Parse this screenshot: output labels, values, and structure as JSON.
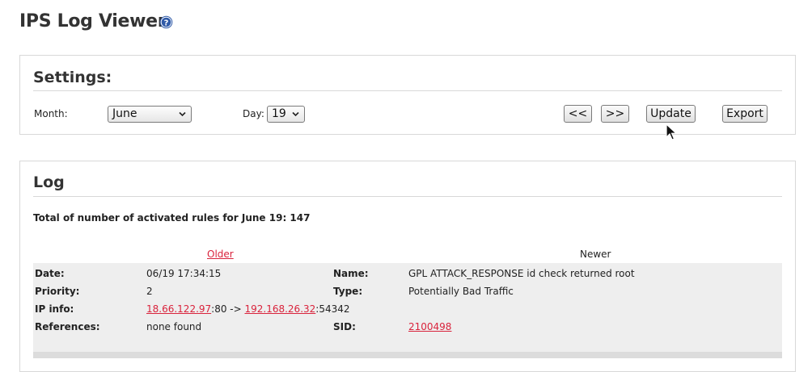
{
  "page": {
    "title": "IPS Log Viewer"
  },
  "settings": {
    "heading": "Settings:",
    "month_label": "Month:",
    "month_value": "June",
    "day_label": "Day:",
    "day_value": "19",
    "prev_label": "<<",
    "next_label": ">>",
    "update_label": "Update",
    "export_label": "Export"
  },
  "log": {
    "heading": "Log",
    "summary": "Total of number of activated rules for June 19: 147",
    "older": "Older",
    "newer": "Newer",
    "entry": {
      "date_key": "Date:",
      "date": "06/19 17:34:15",
      "name_key": "Name:",
      "name": "GPL ATTACK_RESPONSE id check returned root",
      "priority_key": "Priority:",
      "priority": "2",
      "type_key": "Type:",
      "type": "Potentially Bad Traffic",
      "ipinfo_key": "IP info:",
      "src_ip": "18.66.122.97",
      "src_port": ":80 -> ",
      "dst_ip": "192.168.26.32",
      "dst_port": ":54342",
      "refs_key": "References:",
      "refs": "none found",
      "sid_key": "SID:",
      "sid": "2100498"
    }
  },
  "colors": {
    "link": "#d9233c",
    "help_icon": "#2f5aa8"
  }
}
